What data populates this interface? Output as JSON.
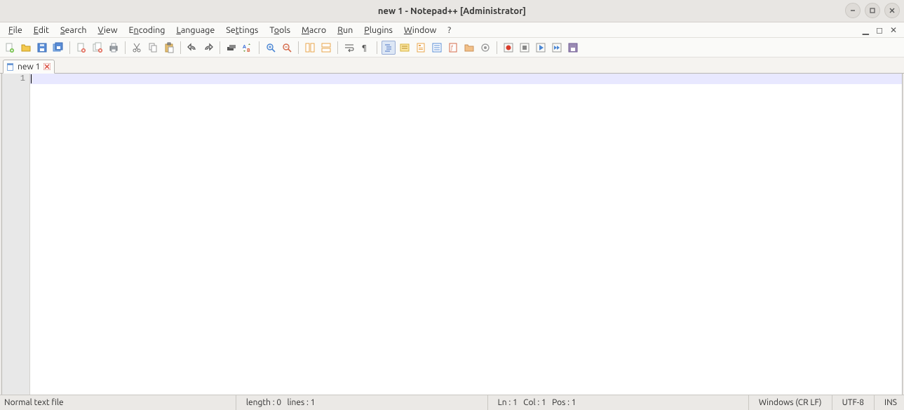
{
  "window": {
    "title": "new 1 - Notepad++ [Administrator]"
  },
  "menus": {
    "file": "File",
    "edit": "Edit",
    "search": "Search",
    "view": "View",
    "encoding": "Encoding",
    "language": "Language",
    "settings": "Settings",
    "tools": "Tools",
    "macro": "Macro",
    "run": "Run",
    "plugins": "Plugins",
    "window": "Window",
    "help": "?"
  },
  "toolbar": {
    "new": "new",
    "open": "open",
    "save": "save",
    "save_all": "save-all",
    "close": "close",
    "close_all": "close-all",
    "print": "print",
    "cut": "cut",
    "copy": "copy",
    "paste": "paste",
    "undo": "undo",
    "redo": "redo",
    "find": "find",
    "replace": "replace",
    "zoom_in": "zoom-in",
    "zoom_out": "zoom-out",
    "sync_v": "sync-vertical",
    "sync_h": "sync-horizontal",
    "wrap": "word-wrap",
    "show_all": "show-all-chars",
    "indent_guide": "indent-guide",
    "userlang": "user-lang",
    "docmap": "doc-map",
    "doclist": "doc-list",
    "func_list": "function-list",
    "folder": "folder-workspace",
    "monitor": "monitoring",
    "record": "record-macro",
    "stop": "stop-macro",
    "play": "play-macro",
    "play_multi": "play-multi",
    "save_macro": "save-macro"
  },
  "tabs": [
    {
      "label": "new 1"
    }
  ],
  "editor": {
    "line_numbers": [
      "1"
    ],
    "content": ""
  },
  "status": {
    "file_type": "Normal text file",
    "length_label": "length : 0",
    "lines_label": "lines : 1",
    "ln_label": "Ln : 1",
    "col_label": "Col : 1",
    "pos_label": "Pos : 1",
    "eol": "Windows (CR LF)",
    "encoding": "UTF-8",
    "insert_mode": "INS"
  }
}
